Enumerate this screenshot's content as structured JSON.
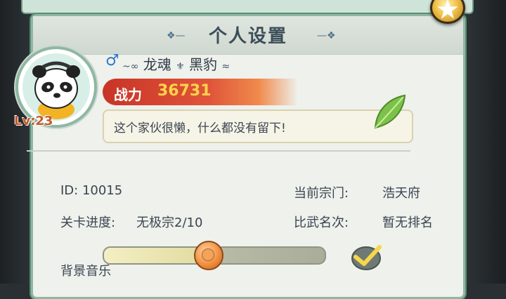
{
  "window": {
    "title": "个人设置",
    "close_icon": "close-star-icon"
  },
  "profile": {
    "level_text": "Lv:23",
    "gender_symbol": "♂",
    "name": "龙魂",
    "name_suffix": "黑豹",
    "power_label": "战力",
    "power_value": "36731",
    "motto": "这个家伙很懒，什么都没有留下!"
  },
  "info": {
    "id_text": "ID: 10015",
    "sect_label": "当前宗门:",
    "sect_value": "浩天府",
    "progress_label": "关卡进度:",
    "progress_value": "无极宗2/10",
    "rank_label": "比武名次:",
    "rank_value": "暂无排名"
  },
  "settings": {
    "bg_music_label": "背景音乐",
    "bg_music_level": 0.47,
    "bg_music_enabled": true
  },
  "colors": {
    "accent_green": "#8fb7a2",
    "power_red": "#c83426",
    "power_value": "#ffd24b",
    "gender_blue": "#2f79c9",
    "level_orange": "#c45a2a"
  }
}
